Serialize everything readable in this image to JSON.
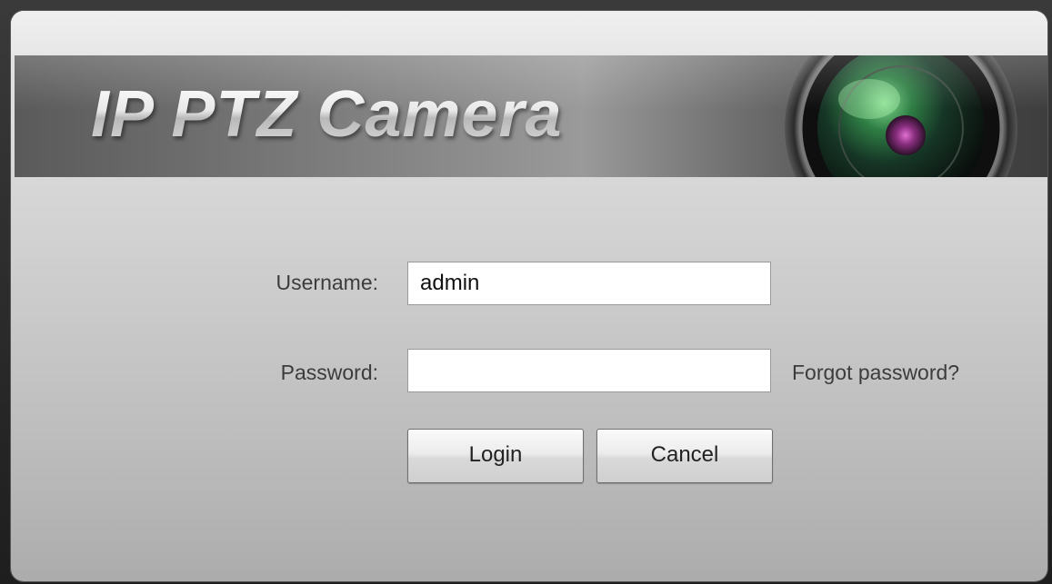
{
  "window": {
    "brand_title": "IP PTZ Camera"
  },
  "login_form": {
    "username_label": "Username:",
    "username_value": "admin",
    "password_label": "Password:",
    "password_value": "",
    "forgot_password_label": "Forgot password?",
    "login_label": "Login",
    "cancel_label": "Cancel"
  },
  "icons": {
    "banner_graphic": "camera-lens-icon"
  },
  "colors": {
    "banner_gray": "#6e6e6e",
    "dialog_background": "#d6d6d6",
    "label_text": "#3c3c3c"
  }
}
